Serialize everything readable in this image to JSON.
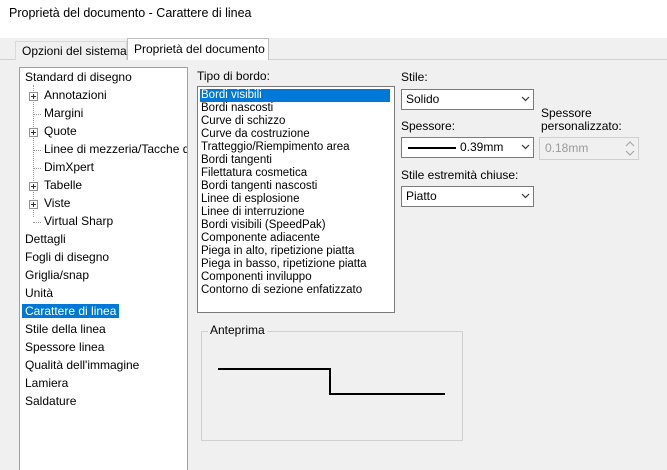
{
  "window": {
    "title": "Proprietà del documento - Carattere di linea"
  },
  "tabs": [
    {
      "label": "Opzioni del sistema"
    },
    {
      "label": "Proprietà del documento"
    }
  ],
  "tree": {
    "items": [
      {
        "label": "Standard di disegno"
      },
      {
        "label": "Annotazioni"
      },
      {
        "label": "Margini"
      },
      {
        "label": "Quote"
      },
      {
        "label": "Linee di mezzeria/Tacche di"
      },
      {
        "label": "DimXpert"
      },
      {
        "label": "Tabelle"
      },
      {
        "label": "Viste"
      },
      {
        "label": "Virtual Sharp"
      },
      {
        "label": "Dettagli"
      },
      {
        "label": "Fogli di disegno"
      },
      {
        "label": "Griglia/snap"
      },
      {
        "label": "Unità"
      },
      {
        "label": "Carattere di linea"
      },
      {
        "label": "Stile della linea"
      },
      {
        "label": "Spessore linea"
      },
      {
        "label": "Qualità dell'immagine"
      },
      {
        "label": "Lamiera"
      },
      {
        "label": "Saldature"
      }
    ]
  },
  "edge_type": {
    "label": "Tipo di bordo:",
    "items": [
      "Bordi visibili",
      "Bordi nascosti",
      "Curve di schizzo",
      "Curve da costruzione",
      "Tratteggio/Riempimento area",
      "Bordi tangenti",
      "Filettatura cosmetica",
      "Bordi tangenti nascosti",
      "Linee di esplosione",
      "Linee di interruzione",
      "Bordi visibili (SpeedPak)",
      "Componente adiacente",
      "Piega in alto, ripetizione piatta",
      "Piega in basso, ripetizione piatta",
      "Componenti inviluppo",
      "Contorno di sezione enfatizzato"
    ]
  },
  "style": {
    "label": "Stile:",
    "value": "Solido"
  },
  "thickness": {
    "label": "Spessore:",
    "value": "0.39mm"
  },
  "custom_thickness": {
    "label_line1": "Spessore",
    "label_line2": "personalizzato:",
    "value": "0.18mm"
  },
  "end_cap": {
    "label": "Stile estremità chiuse:",
    "value": "Piatto"
  },
  "preview": {
    "label": "Anteprima"
  }
}
